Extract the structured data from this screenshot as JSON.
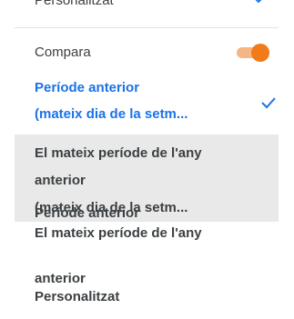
{
  "header": {
    "label": "Personalitzat",
    "chevron_icon": "chevron-down-icon"
  },
  "compare": {
    "label": "Compara",
    "enabled": true,
    "toggle_color": "#f07b18"
  },
  "options": [
    {
      "line1": "Període anterior",
      "line2": "(mateix dia de la setm...",
      "selected": true
    },
    {
      "line1": "El mateix període de l'any",
      "line2": "anterior"
    },
    {
      "line1": "(mateix dia de la setm...",
      "line2": "Període anterior"
    },
    {
      "line1": "El mateix període de l'any",
      "line2": "anterior"
    },
    {
      "line1": "Personalitzat"
    }
  ],
  "colors": {
    "accent": "#1a73e8",
    "toggle_track": "#f5b585",
    "hover": "#e9e9e9"
  }
}
